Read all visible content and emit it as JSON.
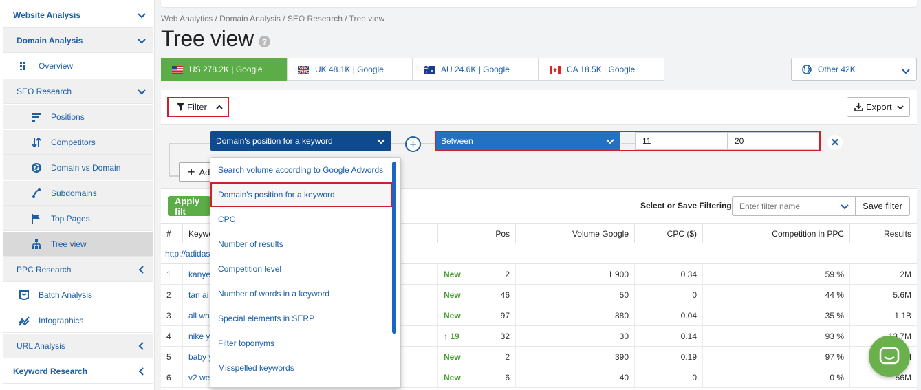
{
  "sidebar": {
    "items": [
      {
        "label": "Website Analysis",
        "chevron": "down"
      },
      {
        "label": "Domain Analysis",
        "chevron": "down"
      },
      {
        "label": "Overview",
        "icon": "overview-icon"
      },
      {
        "label": "SEO Research",
        "chevron": "down"
      },
      {
        "label": "Positions",
        "icon": "positions-icon"
      },
      {
        "label": "Competitors",
        "icon": "competitors-icon"
      },
      {
        "label": "Domain vs Domain",
        "icon": "domain-vs-domain-icon"
      },
      {
        "label": "Subdomains",
        "icon": "subdomains-icon"
      },
      {
        "label": "Top Pages",
        "icon": "flag-icon"
      },
      {
        "label": "Tree view",
        "icon": "tree-icon",
        "active": true
      },
      {
        "label": "PPC Research",
        "chevron": "left"
      },
      {
        "label": "Batch Analysis",
        "icon": "batch-icon"
      },
      {
        "label": "Infographics",
        "icon": "infographics-icon"
      },
      {
        "label": "URL Analysis",
        "chevron": "left"
      },
      {
        "label": "Keyword Research",
        "chevron": "left"
      }
    ]
  },
  "breadcrumb": "Web Analytics / Domain Analysis / SEO Research / Tree view",
  "title": "Tree view",
  "help_symbol": "?",
  "db_tabs": [
    {
      "label": "US 278.2K | Google",
      "flag": "us-flag-icon",
      "active": true
    },
    {
      "label": "UK 48.1K | Google",
      "flag": "uk-flag-icon"
    },
    {
      "label": "AU 24.6K | Google",
      "flag": "au-flag-icon"
    },
    {
      "label": "CA 18.5K | Google",
      "flag": "ca-flag-icon"
    }
  ],
  "other_db": "Other 42K",
  "toolbar": {
    "filter_label": "Filter",
    "export_label": "Export"
  },
  "filter": {
    "field": "Domain's position for a keyword",
    "operator": "Between",
    "value_from": "11",
    "value_to": "20",
    "add_label": "Ad",
    "apply_label": "Apply filt",
    "save_or_select_label": "Select or Save Filtering:",
    "filter_name_placeholder": "Enter filter name",
    "save_filter_label": "Save filter"
  },
  "dropdown_options": [
    "Search volume according to Google Adwords",
    "Domain's position for a keyword",
    "CPC",
    "Number of results",
    "Competition level",
    "Number of words in a keyword",
    "Special elements in SERP",
    "Filter toponyms",
    "Misspelled keywords"
  ],
  "dropdown_selected_index": 1,
  "table": {
    "headers": {
      "num": "#",
      "keyword": "Keywo",
      "pos": "Pos",
      "volume": "Volume Google",
      "cpc": "CPC ($)",
      "competition": "Competition in PPC",
      "results": "Results"
    },
    "domain": "http://adidas",
    "rows": [
      {
        "n": "1",
        "kw": "kanye",
        "change": "New",
        "pos": "2",
        "volume": "1 900",
        "cpc": "0.34",
        "comp": "59 %",
        "results": "2M"
      },
      {
        "n": "2",
        "kw": "tan ai",
        "change": "New",
        "pos": "46",
        "volume": "50",
        "cpc": "0",
        "comp": "44 %",
        "results": "5.6M"
      },
      {
        "n": "3",
        "kw": "all wh",
        "change": "New",
        "pos": "97",
        "volume": "880",
        "cpc": "0.04",
        "comp": "35 %",
        "results": "1.1B"
      },
      {
        "n": "4",
        "kw": "nike y",
        "change": "↑ 19",
        "pos": "32",
        "volume": "30",
        "cpc": "0.14",
        "comp": "93 %",
        "results": "13.7M"
      },
      {
        "n": "5",
        "kw": "baby y",
        "change": "New",
        "pos": "2",
        "volume": "390",
        "cpc": "0.19",
        "comp": "97 %",
        "results": "5.1M"
      },
      {
        "n": "6",
        "kw": "v2 we",
        "change": "New",
        "pos": "6",
        "volume": "40",
        "cpc": "0",
        "comp": "0 %",
        "results": "56M"
      }
    ]
  },
  "colors": {
    "accent_blue": "#1a5ea8",
    "green": "#5cac47",
    "highlight_red": "#d01f2a",
    "dark_blue_select": "#0f4a8e"
  }
}
